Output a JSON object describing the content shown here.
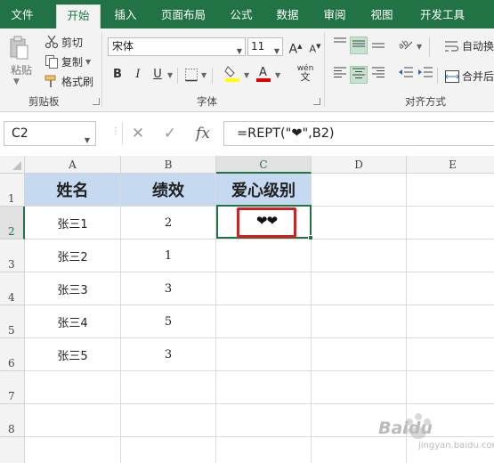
{
  "ribbon_tabs": [
    "文件",
    "开始",
    "插入",
    "页面布局",
    "公式",
    "数据",
    "审阅",
    "视图",
    "开发工具"
  ],
  "clipboard": {
    "paste_label": "粘贴",
    "cut_label": "剪切",
    "copy_label": "复制",
    "format_painter_label": "格式刷",
    "group_label": "剪贴板"
  },
  "font": {
    "name": "宋体",
    "size": "11",
    "group_label": "字体",
    "bold": "B",
    "italic": "I",
    "underline": "U",
    "grow": "A",
    "shrink": "A",
    "phonetic": "wén"
  },
  "alignment": {
    "group_label": "对齐方式",
    "wrap_text_label": "自动换",
    "merge_label": "合并后"
  },
  "formula_bar": {
    "name_box": "C2",
    "fx_label": "fx",
    "formula": "=REPT(\"❤\",B2)"
  },
  "columns": [
    "A",
    "B",
    "C",
    "D",
    "E"
  ],
  "rows": [
    "1",
    "2",
    "3",
    "4",
    "5",
    "6",
    "7",
    "8"
  ],
  "table": {
    "headers": [
      "姓名",
      "绩效",
      "爱心级别"
    ],
    "rows": [
      [
        "张三1",
        "2",
        "❤❤"
      ],
      [
        "张三2",
        "1",
        ""
      ],
      [
        "张三3",
        "3",
        ""
      ],
      [
        "张三4",
        "5",
        ""
      ],
      [
        "张三5",
        "3",
        ""
      ]
    ]
  },
  "selected_cell": "C2",
  "watermark": {
    "text": "Baidu",
    "sub": "jingyan.baidu.com"
  },
  "colors": {
    "ribbon_green": "#217346",
    "header_fill": "#c5d9f1",
    "highlight_red": "#d61e1e"
  }
}
